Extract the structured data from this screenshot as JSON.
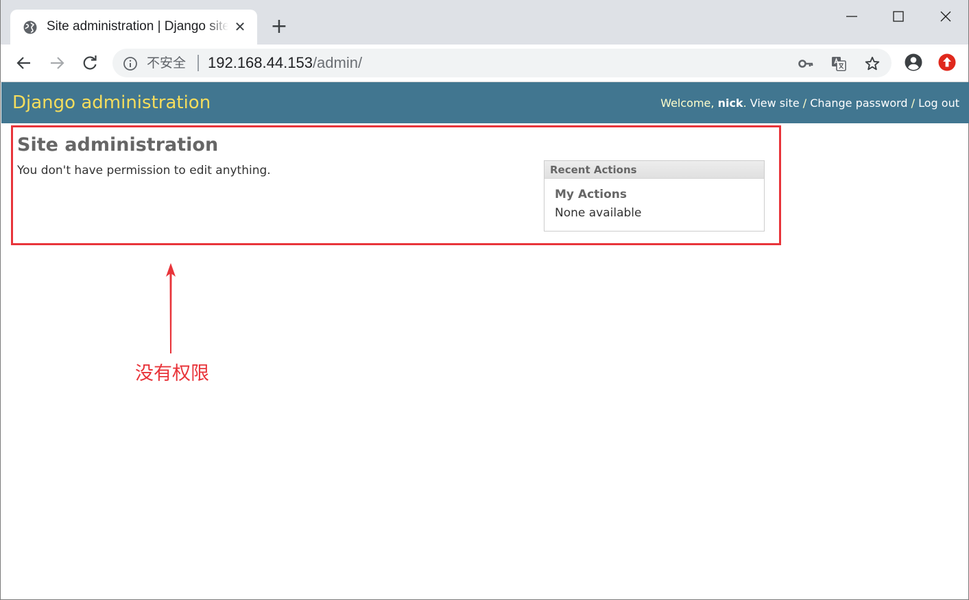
{
  "browser": {
    "tab_title": "Site administration | Django site admin",
    "close_glyph": "✕",
    "new_tab_glyph": "+",
    "security_label": "不安全",
    "url_host": "192.168.44.153",
    "url_path": "/admin/",
    "icons": [
      "globe-icon",
      "minimize-icon",
      "maximize-icon",
      "close-window-icon",
      "back-icon",
      "forward-icon",
      "reload-icon",
      "info-icon",
      "key-icon",
      "translate-icon",
      "star-icon",
      "account-icon",
      "update-icon"
    ]
  },
  "header": {
    "branding": "Django administration",
    "welcome": "Welcome, ",
    "username": "nick",
    "period": ". ",
    "view_site": "View site",
    "sep": " / ",
    "change_password": "Change password",
    "log_out": "Log out",
    "background": "#417690",
    "branding_color": "#f5dd5d"
  },
  "content": {
    "title": "Site administration",
    "message": "You don't have permission to edit anything."
  },
  "recent_actions": {
    "caption": "Recent Actions",
    "my_actions": "My Actions",
    "none": "None available"
  },
  "annotation": {
    "label": "没有权限",
    "color": "#e8343a"
  }
}
